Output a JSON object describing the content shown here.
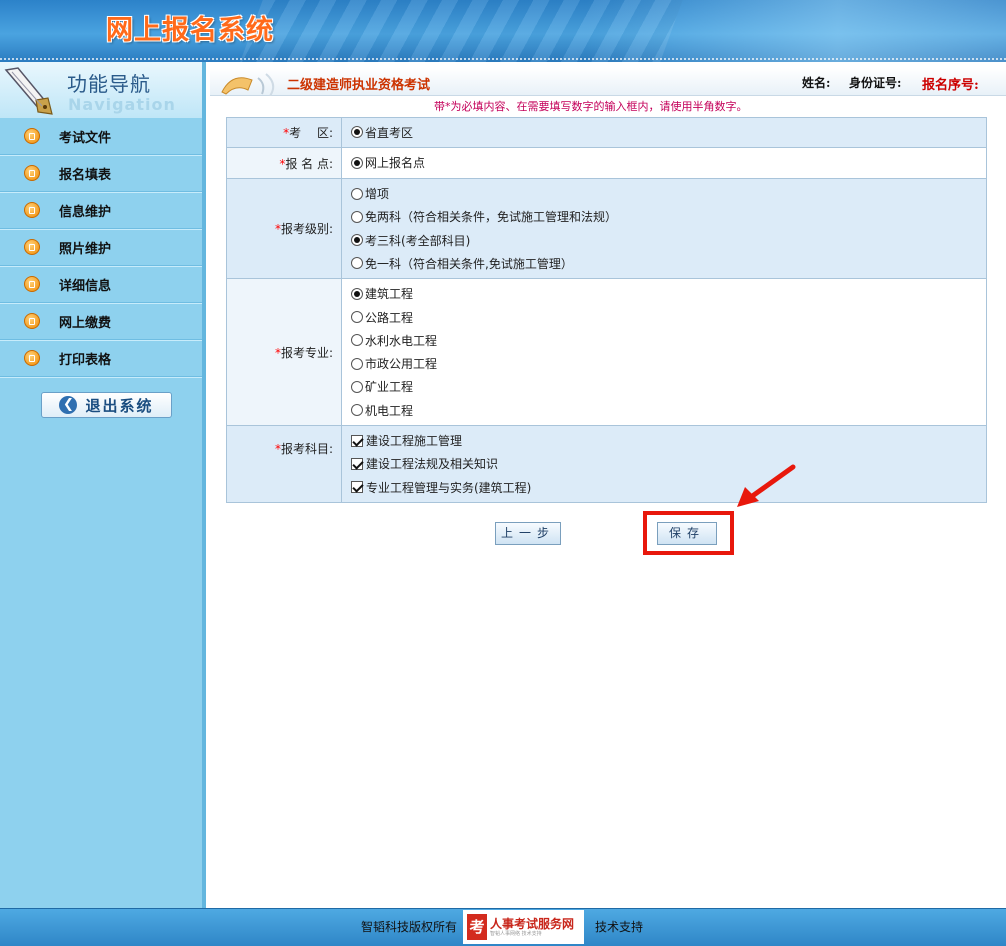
{
  "app": {
    "title": "网上报名系统"
  },
  "nav": {
    "title": "功能导航",
    "subtitle": "Navigation",
    "items": [
      {
        "label": "考试文件"
      },
      {
        "label": "报名填表"
      },
      {
        "label": "信息维护"
      },
      {
        "label": "照片维护"
      },
      {
        "label": "详细信息"
      },
      {
        "label": "网上缴费"
      },
      {
        "label": "打印表格"
      }
    ],
    "logout_label": "退出系统"
  },
  "header": {
    "exam_title": "二级建造师执业资格考试",
    "name_label": "姓名:",
    "id_label": "身份证号:",
    "seq_label": "报名序号:"
  },
  "notice": "带*为必填内容、在需要填写数字的输入框内，请使用半角数字。",
  "form": {
    "region": {
      "star": "*",
      "label": "考　 区:",
      "options": [
        {
          "label": "省直考区",
          "checked": true
        }
      ]
    },
    "site": {
      "star": "*",
      "label": "报 名 点:",
      "options": [
        {
          "label": "网上报名点",
          "checked": true
        }
      ]
    },
    "level": {
      "star": "*",
      "label": "报考级别:",
      "options": [
        {
          "label": "增项",
          "checked": false
        },
        {
          "label": "免两科（符合相关条件，免试施工管理和法规）",
          "checked": false
        },
        {
          "label": "考三科(考全部科目)",
          "checked": true
        },
        {
          "label": "免一科（符合相关条件,免试施工管理）",
          "checked": false
        }
      ]
    },
    "major": {
      "star": "*",
      "label": "报考专业:",
      "options": [
        {
          "label": "建筑工程",
          "checked": true
        },
        {
          "label": "公路工程",
          "checked": false
        },
        {
          "label": "水利水电工程",
          "checked": false
        },
        {
          "label": "市政公用工程",
          "checked": false
        },
        {
          "label": "矿业工程",
          "checked": false
        },
        {
          "label": "机电工程",
          "checked": false
        }
      ]
    },
    "subjects": {
      "star": "*",
      "label": "报考科目:",
      "options": [
        {
          "label": "建设工程施工管理",
          "checked": true
        },
        {
          "label": "建设工程法规及相关知识",
          "checked": true
        },
        {
          "label": "专业工程管理与实务(建筑工程)",
          "checked": true
        }
      ]
    }
  },
  "buttons": {
    "prev": "上一步",
    "save": "保存"
  },
  "footer": {
    "copyright": "智韬科技版权所有",
    "logo_char": "考",
    "logo_text": "人事考试服务网",
    "logo_sub": "智韬人事网络 技术支持",
    "support": "技术支持"
  }
}
